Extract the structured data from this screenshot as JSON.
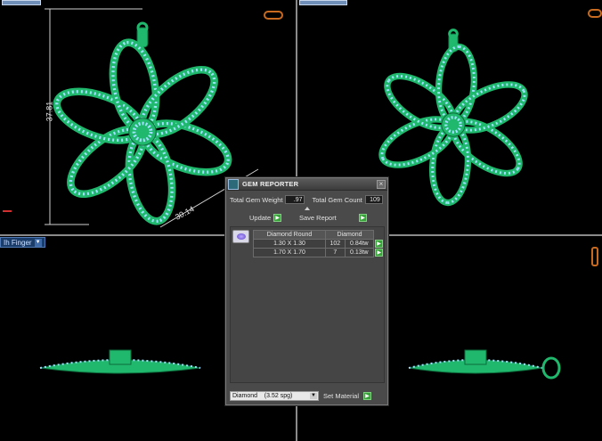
{
  "colors": {
    "metal": "#1fb86c",
    "metal_dark": "#0d6b3c",
    "stone": "#9fe0ff",
    "panel_bg": "#4a4a4a",
    "accent_green": "#3aa23a"
  },
  "viewports": {
    "top_left": {
      "dim_height": "37.81",
      "dim_diagonal": "30.14"
    },
    "bottom_left": {
      "view_select": "Ih Finger"
    }
  },
  "gem_reporter": {
    "title": "GEM REPORTER",
    "total_weight_label": "Total Gem Weight",
    "total_weight_value": ".97",
    "total_count_label": "Total Gem Count",
    "total_count_value": "109",
    "update_label": "Update",
    "save_report_label": "Save Report",
    "table": {
      "headers": [
        "Diamond Round",
        "Diamond"
      ],
      "rows": [
        {
          "size": "1.30 X 1.30",
          "count": "102",
          "weight": "0.84tw"
        },
        {
          "size": "1.70 X 1.70",
          "count": "7",
          "weight": "0.13tw"
        }
      ]
    },
    "material_select": "Diamond    (3.52 spg)",
    "set_material_label": "Set Material"
  },
  "icons": {
    "close": "close-icon",
    "gem": "gem-icon",
    "play": "play-icon",
    "dropdown": "chevron-down-icon"
  }
}
